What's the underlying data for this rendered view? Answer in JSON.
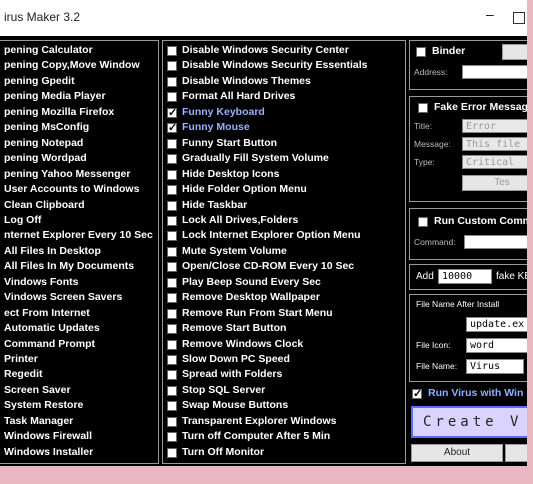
{
  "window": {
    "title": "irus Maker 3.2",
    "minimize": "–"
  },
  "options_left": [
    "pening Calculator",
    "pening Copy,Move Window",
    "pening Gpedit",
    "pening Media Player",
    "pening Mozilla Firefox",
    "pening MsConfig",
    "pening Notepad",
    "pening Wordpad",
    "pening Yahoo Messenger",
    "User Accounts to Windows",
    "Clean Clipboard",
    "Log Off",
    "nternet Explorer Every 10 Sec",
    "All Files In Desktop",
    "All Files In My Documents",
    "Vindows Fonts",
    "Vindows Screen Savers",
    "ect From Internet",
    "Automatic Updates",
    "Command Prompt",
    "Printer",
    "Regedit",
    "Screen Saver",
    "System Restore",
    "Task Manager",
    "Windows Firewall",
    "Windows Installer"
  ],
  "options_right": [
    {
      "label": "Disable Windows Security Center",
      "checked": false
    },
    {
      "label": "Disable Windows Security Essentials",
      "checked": false
    },
    {
      "label": "Disable Windows Themes",
      "checked": false
    },
    {
      "label": "Format All Hard Drives",
      "checked": false
    },
    {
      "label": "Funny Keyboard",
      "checked": true
    },
    {
      "label": "Funny Mouse",
      "checked": true
    },
    {
      "label": "Funny Start Button",
      "checked": false
    },
    {
      "label": "Gradually Fill System Volume",
      "checked": false
    },
    {
      "label": "Hide Desktop Icons",
      "checked": false
    },
    {
      "label": "Hide Folder Option Menu",
      "checked": false
    },
    {
      "label": "Hide Taskbar",
      "checked": false
    },
    {
      "label": "Lock All Drives,Folders",
      "checked": false
    },
    {
      "label": "Lock Internet Explorer Option Menu",
      "checked": false
    },
    {
      "label": "Mute System Volume",
      "checked": false
    },
    {
      "label": "Open/Close CD-ROM Every 10 Sec",
      "checked": false
    },
    {
      "label": "Play Beep Sound Every Sec",
      "checked": false
    },
    {
      "label": "Remove Desktop Wallpaper",
      "checked": false
    },
    {
      "label": "Remove Run From Start Menu",
      "checked": false
    },
    {
      "label": "Remove Start Button",
      "checked": false
    },
    {
      "label": "Remove Windows Clock",
      "checked": false
    },
    {
      "label": "Slow Down PC Speed",
      "checked": false
    },
    {
      "label": "Spread with Folders",
      "checked": false
    },
    {
      "label": "Stop SQL Server",
      "checked": false
    },
    {
      "label": "Swap Mouse Buttons",
      "checked": false
    },
    {
      "label": "Transparent Explorer Windows",
      "checked": false
    },
    {
      "label": "Turn off Computer After 5 Min",
      "checked": false
    },
    {
      "label": "Turn Off Monitor",
      "checked": false
    }
  ],
  "binder": {
    "label": "Binder",
    "address_label": "Address:"
  },
  "fake_error": {
    "label": "Fake Error Messag",
    "title_label": "Title:",
    "title_value": "Error",
    "message_label": "Message:",
    "message_value": "This file",
    "type_label": "Type:",
    "type_value": "Critical",
    "test_label": "Tes"
  },
  "custom_command": {
    "label": "Run Custom Comm",
    "command_label": "Command:"
  },
  "add": {
    "label": "Add",
    "value": "10000",
    "suffix": "fake KB"
  },
  "file_name_after_install": {
    "label": "File Name After Install",
    "value": "update.ex",
    "icon_label": "File Icon:",
    "icon_value": "word",
    "name_label": "File Name:",
    "name_value": "Virus"
  },
  "run_virus": {
    "label": "Run Virus with Win",
    "checked": true
  },
  "create_button": "Create V",
  "about_button": "About",
  "colors": {
    "window_bg": "#000000",
    "text": "#ffffff",
    "accent_blue": "#9ab0ff",
    "page_bg": "#e8b7c2",
    "create_bg": "#d8d4ff"
  }
}
